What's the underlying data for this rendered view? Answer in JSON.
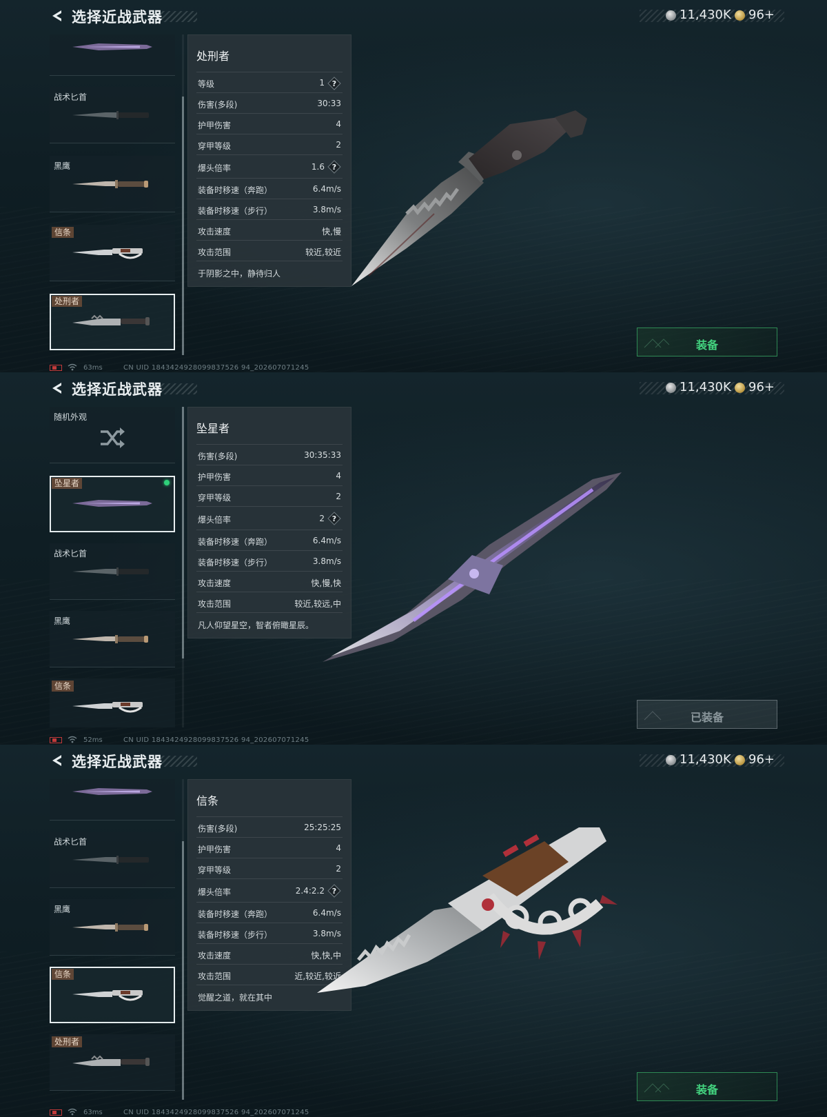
{
  "title": "选择近战武器",
  "currency": {
    "silver": "11,430K",
    "gold": "96+"
  },
  "panels": [
    {
      "items": [
        {
          "label": "",
          "knife": "starfall"
        },
        {
          "label": "战术匕首",
          "knife": "tactical"
        },
        {
          "label": "黑鹰",
          "knife": "hawk"
        },
        {
          "tag": "信条",
          "knife": "creed"
        },
        {
          "tag": "处刑者",
          "knife": "executioner",
          "selected": true
        }
      ],
      "info": {
        "name": "处刑者",
        "stats": [
          {
            "label": "等级",
            "value": "1",
            "help": true
          },
          {
            "label": "伤害(多段)",
            "value": "30:33"
          },
          {
            "label": "护甲伤害",
            "value": "4"
          },
          {
            "label": "穿甲等级",
            "value": "2"
          },
          {
            "label": "爆头倍率",
            "value": "1.6",
            "help": true
          },
          {
            "label": "装备时移速（奔跑）",
            "value": "6.4m/s"
          },
          {
            "label": "装备时移速（步行）",
            "value": "3.8m/s"
          },
          {
            "label": "攻击速度",
            "value": "快,慢"
          },
          {
            "label": "攻击范围",
            "value": "较近,较近"
          }
        ],
        "flavor": "于阴影之中，静待归人"
      },
      "equip_label": "装备",
      "ping": "63ms",
      "uid": "CN UID 1843424928099837526 94_202607071245"
    },
    {
      "items": [
        {
          "label": "随机外观",
          "knife": "random"
        },
        {
          "tag": "坠星者",
          "knife": "starfall",
          "selected": true,
          "equipped": true
        },
        {
          "label": "战术匕首",
          "knife": "tactical"
        },
        {
          "label": "黑鹰",
          "knife": "hawk"
        },
        {
          "tag": "信条",
          "knife": "creed"
        }
      ],
      "info": {
        "name": "坠星者",
        "stats": [
          {
            "label": "伤害(多段)",
            "value": "30:35:33"
          },
          {
            "label": "护甲伤害",
            "value": "4"
          },
          {
            "label": "穿甲等级",
            "value": "2"
          },
          {
            "label": "爆头倍率",
            "value": "2",
            "help": true
          },
          {
            "label": "装备时移速（奔跑）",
            "value": "6.4m/s"
          },
          {
            "label": "装备时移速（步行）",
            "value": "3.8m/s"
          },
          {
            "label": "攻击速度",
            "value": "快,慢,快"
          },
          {
            "label": "攻击范围",
            "value": "较近,较远,中"
          }
        ],
        "flavor": "凡人仰望星空，智者俯瞰星辰。"
      },
      "equip_label": "已装备",
      "ping": "52ms",
      "uid": "CN UID 1843424928099837526 94_202607071245"
    },
    {
      "items": [
        {
          "label": "",
          "knife": "starfall"
        },
        {
          "label": "战术匕首",
          "knife": "tactical"
        },
        {
          "label": "黑鹰",
          "knife": "hawk"
        },
        {
          "tag": "信条",
          "knife": "creed",
          "selected": true
        },
        {
          "tag": "处刑者",
          "knife": "executioner"
        }
      ],
      "info": {
        "name": "信条",
        "stats": [
          {
            "label": "伤害(多段)",
            "value": "25:25:25"
          },
          {
            "label": "护甲伤害",
            "value": "4"
          },
          {
            "label": "穿甲等级",
            "value": "2"
          },
          {
            "label": "爆头倍率",
            "value": "2.4:2.2",
            "help": true
          },
          {
            "label": "装备时移速（奔跑）",
            "value": "6.4m/s"
          },
          {
            "label": "装备时移速（步行）",
            "value": "3.8m/s"
          },
          {
            "label": "攻击速度",
            "value": "快,快,中"
          },
          {
            "label": "攻击范围",
            "value": "近,较近,较近"
          }
        ],
        "flavor": "觉醒之道，就在其中"
      },
      "equip_label": "装备",
      "ping": "63ms",
      "uid": "CN UID 1843424928099837526 94_202607071245"
    }
  ]
}
